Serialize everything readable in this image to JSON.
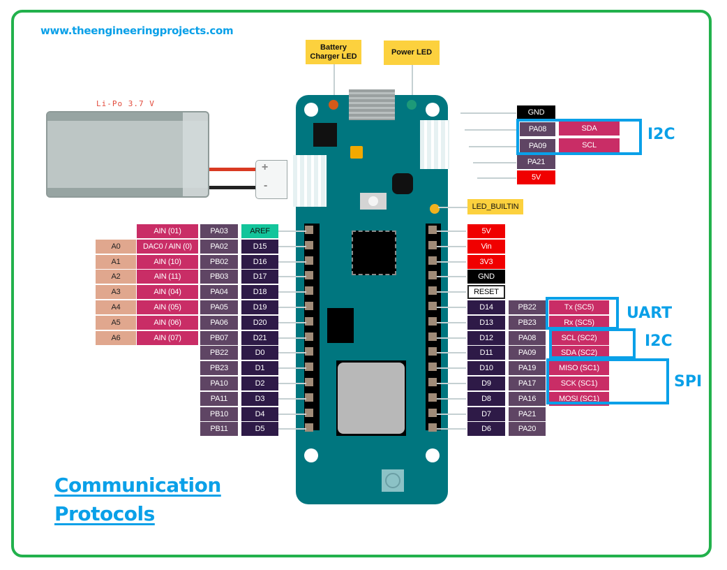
{
  "site_url": "www.theengineeringprojects.com",
  "title_line1": "Communication",
  "title_line2": "Protocols",
  "battery": {
    "label": "Li-Po 3.7 V",
    "plus": "+",
    "minus": "-"
  },
  "led_labels": {
    "battery_charger": "Battery Charger LED",
    "power": "Power LED",
    "builtin": "LED_BUILTIN"
  },
  "colors": {
    "frame": "#22b14c",
    "accent": "#0aa0e8",
    "board": "#00767f",
    "analog": "#e0a78e",
    "function": "#c92d66",
    "port": "#5f4564",
    "digital": "#2e1a47",
    "power": "#f00000",
    "aref": "#13c59b"
  },
  "top_header": {
    "pins": [
      "GND",
      "PA08",
      "PA09",
      "PA21",
      "5V"
    ],
    "functions": [
      "SDA",
      "SCL"
    ],
    "protocol": "I2C"
  },
  "left_header": {
    "rows": [
      {
        "analog": "",
        "func": "AIN (01)",
        "port": "PA03",
        "digital": "AREF"
      },
      {
        "analog": "A0",
        "func": "DAC0  /  AIN (0)",
        "port": "PA02",
        "digital": "D15"
      },
      {
        "analog": "A1",
        "func": "AIN (10)",
        "port": "PB02",
        "digital": "D16"
      },
      {
        "analog": "A2",
        "func": "AIN (11)",
        "port": "PB03",
        "digital": "D17"
      },
      {
        "analog": "A3",
        "func": "AIN (04)",
        "port": "PA04",
        "digital": "D18"
      },
      {
        "analog": "A4",
        "func": "AIN (05)",
        "port": "PA05",
        "digital": "D19"
      },
      {
        "analog": "A5",
        "func": "AIN (06)",
        "port": "PA06",
        "digital": "D20"
      },
      {
        "analog": "A6",
        "func": "AIN (07)",
        "port": "PB07",
        "digital": "D21"
      },
      {
        "analog": "",
        "func": "",
        "port": "PB22",
        "digital": "D0"
      },
      {
        "analog": "",
        "func": "",
        "port": "PB23",
        "digital": "D1"
      },
      {
        "analog": "",
        "func": "",
        "port": "PA10",
        "digital": "D2"
      },
      {
        "analog": "",
        "func": "",
        "port": "PA11",
        "digital": "D3"
      },
      {
        "analog": "",
        "func": "",
        "port": "PB10",
        "digital": "D4"
      },
      {
        "analog": "",
        "func": "",
        "port": "PB11",
        "digital": "D5"
      }
    ]
  },
  "right_header": {
    "power": [
      "5V",
      "Vin",
      "3V3",
      "GND",
      "RESET"
    ],
    "rows": [
      {
        "digital": "D14",
        "port": "PB22",
        "func": "Tx (SC5)"
      },
      {
        "digital": "D13",
        "port": "PB23",
        "func": "Rx (SC5)"
      },
      {
        "digital": "D12",
        "port": "PA08",
        "func": "SCL (SC2)"
      },
      {
        "digital": "D11",
        "port": "PA09",
        "func": "SDA (SC2)"
      },
      {
        "digital": "D10",
        "port": "PA19",
        "func": "MISO (SC1)"
      },
      {
        "digital": "D9",
        "port": "PA17",
        "func": "SCK (SC1)"
      },
      {
        "digital": "D8",
        "port": "PA16",
        "func": "MOSI (SC1)"
      },
      {
        "digital": "D7",
        "port": "PA21",
        "func": ""
      },
      {
        "digital": "D6",
        "port": "PA20",
        "func": ""
      }
    ],
    "protocols": {
      "uart": "UART",
      "i2c": "I2C",
      "spi": "SPI"
    }
  }
}
